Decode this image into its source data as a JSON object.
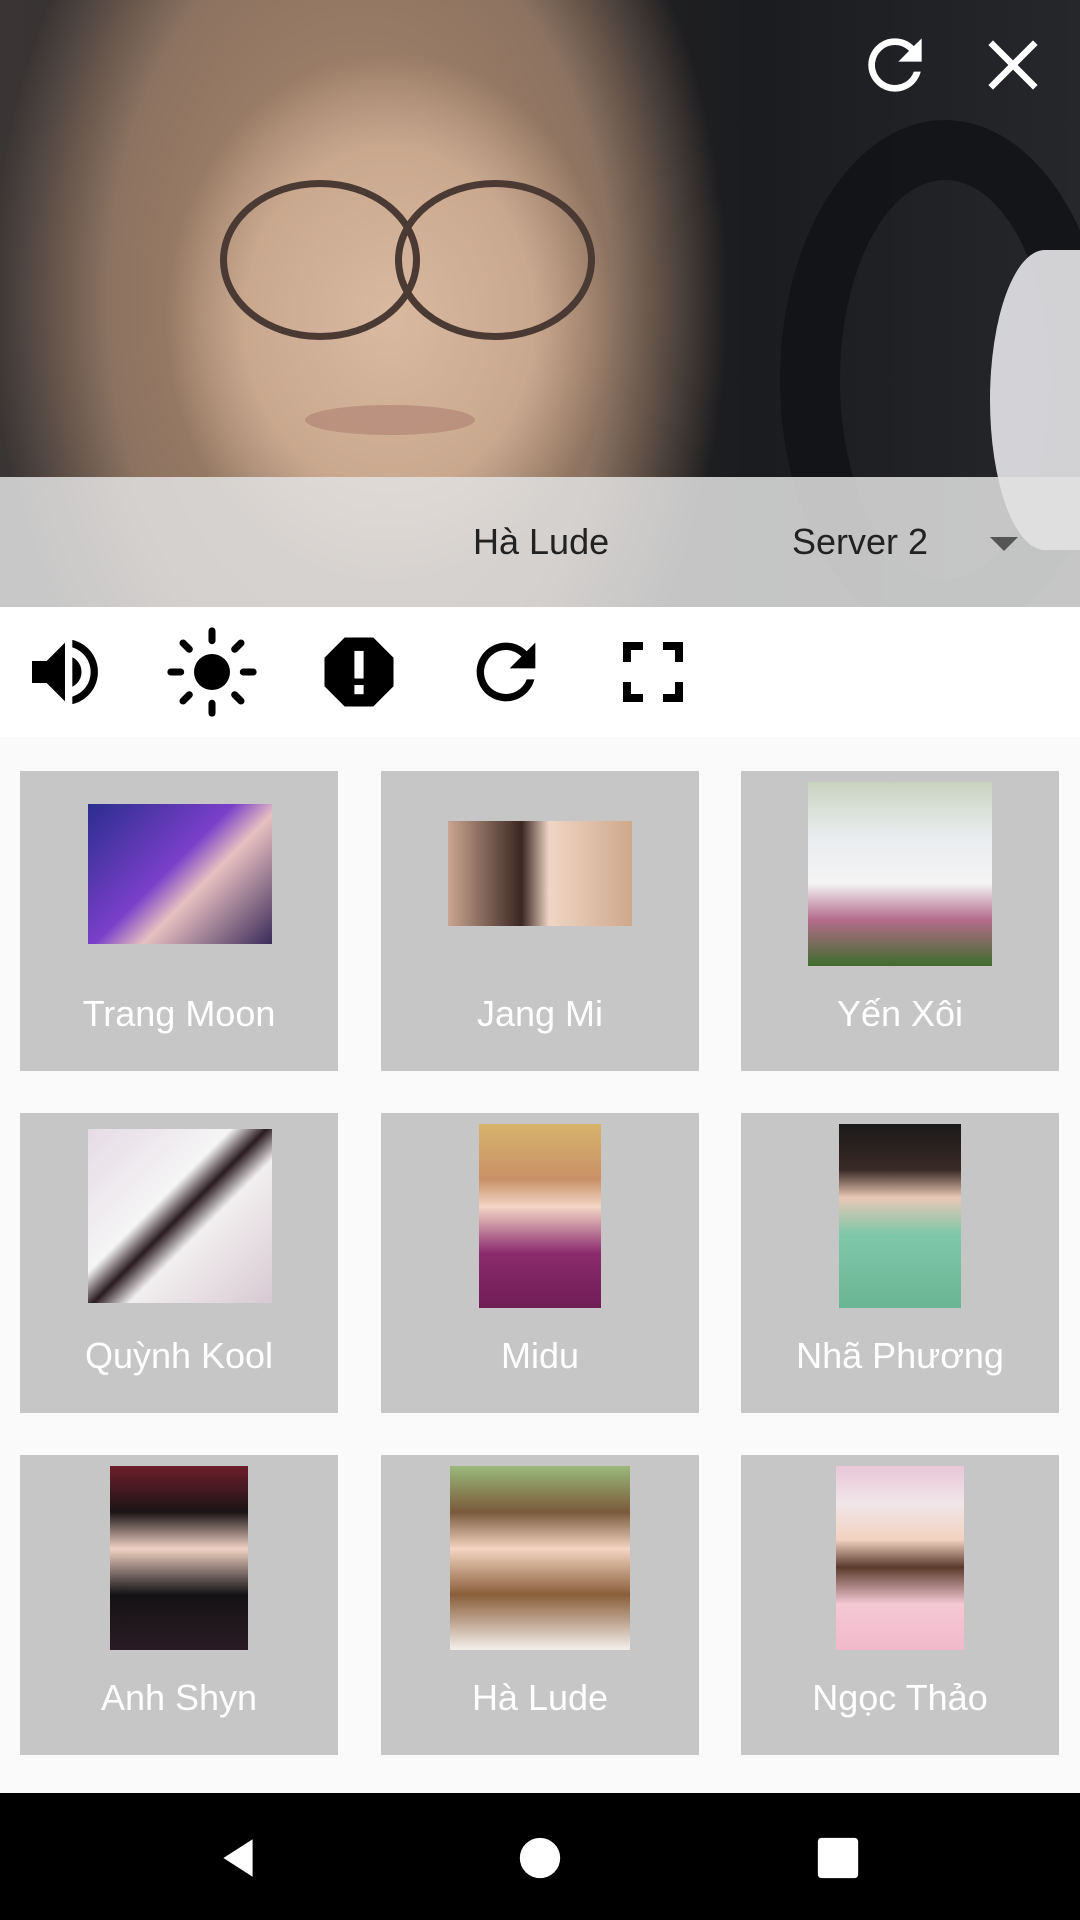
{
  "video": {
    "current_stream_name": "Hà Lude",
    "server": {
      "selected": "Server 2"
    },
    "top_controls": {
      "refresh_icon": "refresh-icon",
      "close_icon": "close-icon"
    }
  },
  "toolbar": {
    "icons": [
      "volume-icon",
      "brightness-icon",
      "report-icon",
      "refresh-icon",
      "fullscreen-icon"
    ]
  },
  "channels": [
    {
      "name": "Trang Moon"
    },
    {
      "name": "Jang Mi"
    },
    {
      "name": "Yến Xôi"
    },
    {
      "name": "Quỳnh Kool"
    },
    {
      "name": "Midu"
    },
    {
      "name": "Nhã Phương"
    },
    {
      "name": "Anh Shyn"
    },
    {
      "name": "Hà Lude"
    },
    {
      "name": "Ngọc Thảo"
    }
  ],
  "navbar": {
    "icons": [
      "back-icon",
      "home-icon",
      "recents-icon"
    ]
  },
  "colors": {
    "card_bg": "#c6c6c6",
    "card_text": "#ffffff",
    "toolbar_bg": "#ffffff",
    "navbar_bg": "#000000"
  }
}
